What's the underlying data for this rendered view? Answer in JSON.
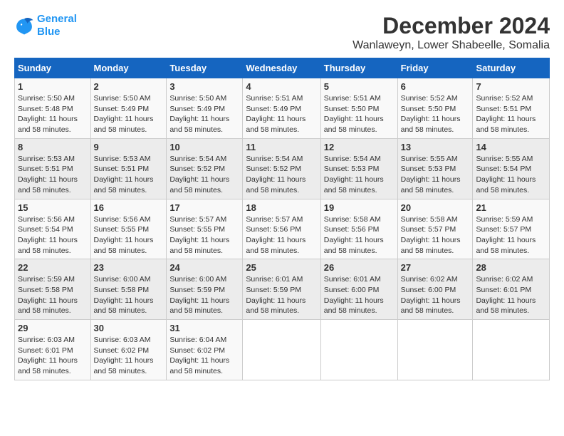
{
  "logo": {
    "line1": "General",
    "line2": "Blue"
  },
  "title": "December 2024",
  "subtitle": "Wanlaweyn, Lower Shabeelle, Somalia",
  "days_of_week": [
    "Sunday",
    "Monday",
    "Tuesday",
    "Wednesday",
    "Thursday",
    "Friday",
    "Saturday"
  ],
  "weeks": [
    [
      {
        "day": "1",
        "sunrise": "5:50 AM",
        "sunset": "5:48 PM",
        "daylight": "11 hours and 58 minutes."
      },
      {
        "day": "2",
        "sunrise": "5:50 AM",
        "sunset": "5:49 PM",
        "daylight": "11 hours and 58 minutes."
      },
      {
        "day": "3",
        "sunrise": "5:50 AM",
        "sunset": "5:49 PM",
        "daylight": "11 hours and 58 minutes."
      },
      {
        "day": "4",
        "sunrise": "5:51 AM",
        "sunset": "5:49 PM",
        "daylight": "11 hours and 58 minutes."
      },
      {
        "day": "5",
        "sunrise": "5:51 AM",
        "sunset": "5:50 PM",
        "daylight": "11 hours and 58 minutes."
      },
      {
        "day": "6",
        "sunrise": "5:52 AM",
        "sunset": "5:50 PM",
        "daylight": "11 hours and 58 minutes."
      },
      {
        "day": "7",
        "sunrise": "5:52 AM",
        "sunset": "5:51 PM",
        "daylight": "11 hours and 58 minutes."
      }
    ],
    [
      {
        "day": "8",
        "sunrise": "5:53 AM",
        "sunset": "5:51 PM",
        "daylight": "11 hours and 58 minutes."
      },
      {
        "day": "9",
        "sunrise": "5:53 AM",
        "sunset": "5:51 PM",
        "daylight": "11 hours and 58 minutes."
      },
      {
        "day": "10",
        "sunrise": "5:54 AM",
        "sunset": "5:52 PM",
        "daylight": "11 hours and 58 minutes."
      },
      {
        "day": "11",
        "sunrise": "5:54 AM",
        "sunset": "5:52 PM",
        "daylight": "11 hours and 58 minutes."
      },
      {
        "day": "12",
        "sunrise": "5:54 AM",
        "sunset": "5:53 PM",
        "daylight": "11 hours and 58 minutes."
      },
      {
        "day": "13",
        "sunrise": "5:55 AM",
        "sunset": "5:53 PM",
        "daylight": "11 hours and 58 minutes."
      },
      {
        "day": "14",
        "sunrise": "5:55 AM",
        "sunset": "5:54 PM",
        "daylight": "11 hours and 58 minutes."
      }
    ],
    [
      {
        "day": "15",
        "sunrise": "5:56 AM",
        "sunset": "5:54 PM",
        "daylight": "11 hours and 58 minutes."
      },
      {
        "day": "16",
        "sunrise": "5:56 AM",
        "sunset": "5:55 PM",
        "daylight": "11 hours and 58 minutes."
      },
      {
        "day": "17",
        "sunrise": "5:57 AM",
        "sunset": "5:55 PM",
        "daylight": "11 hours and 58 minutes."
      },
      {
        "day": "18",
        "sunrise": "5:57 AM",
        "sunset": "5:56 PM",
        "daylight": "11 hours and 58 minutes."
      },
      {
        "day": "19",
        "sunrise": "5:58 AM",
        "sunset": "5:56 PM",
        "daylight": "11 hours and 58 minutes."
      },
      {
        "day": "20",
        "sunrise": "5:58 AM",
        "sunset": "5:57 PM",
        "daylight": "11 hours and 58 minutes."
      },
      {
        "day": "21",
        "sunrise": "5:59 AM",
        "sunset": "5:57 PM",
        "daylight": "11 hours and 58 minutes."
      }
    ],
    [
      {
        "day": "22",
        "sunrise": "5:59 AM",
        "sunset": "5:58 PM",
        "daylight": "11 hours and 58 minutes."
      },
      {
        "day": "23",
        "sunrise": "6:00 AM",
        "sunset": "5:58 PM",
        "daylight": "11 hours and 58 minutes."
      },
      {
        "day": "24",
        "sunrise": "6:00 AM",
        "sunset": "5:59 PM",
        "daylight": "11 hours and 58 minutes."
      },
      {
        "day": "25",
        "sunrise": "6:01 AM",
        "sunset": "5:59 PM",
        "daylight": "11 hours and 58 minutes."
      },
      {
        "day": "26",
        "sunrise": "6:01 AM",
        "sunset": "6:00 PM",
        "daylight": "11 hours and 58 minutes."
      },
      {
        "day": "27",
        "sunrise": "6:02 AM",
        "sunset": "6:00 PM",
        "daylight": "11 hours and 58 minutes."
      },
      {
        "day": "28",
        "sunrise": "6:02 AM",
        "sunset": "6:01 PM",
        "daylight": "11 hours and 58 minutes."
      }
    ],
    [
      {
        "day": "29",
        "sunrise": "6:03 AM",
        "sunset": "6:01 PM",
        "daylight": "11 hours and 58 minutes."
      },
      {
        "day": "30",
        "sunrise": "6:03 AM",
        "sunset": "6:02 PM",
        "daylight": "11 hours and 58 minutes."
      },
      {
        "day": "31",
        "sunrise": "6:04 AM",
        "sunset": "6:02 PM",
        "daylight": "11 hours and 58 minutes."
      },
      null,
      null,
      null,
      null
    ]
  ],
  "labels": {
    "sunrise": "Sunrise: ",
    "sunset": "Sunset: ",
    "daylight": "Daylight: "
  }
}
